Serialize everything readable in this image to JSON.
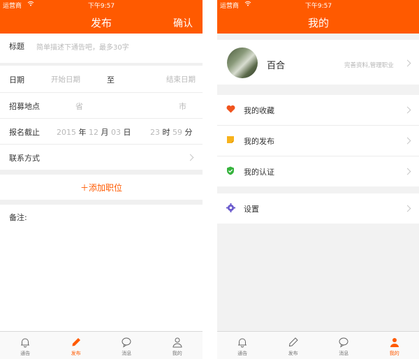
{
  "status_bar": {
    "carrier": "运营商",
    "time": "下午9:57"
  },
  "colors": {
    "brand": "#ff5a00",
    "heart": "#f0541e",
    "note": "#f7b21c",
    "shield": "#36b33d",
    "gear": "#6a5acd"
  },
  "publish": {
    "title": "发布",
    "confirm": "确认",
    "form": {
      "title_label": "标题",
      "title_placeholder": "简单描述下通告吧，最多30字",
      "date_label": "日期",
      "date_start": "开始日期",
      "date_to": "至",
      "date_end": "结束日期",
      "location_label": "招募地点",
      "province": "省",
      "city": "市",
      "deadline_label": "报名截止",
      "deadline_year": "2015",
      "deadline_year_unit": "年",
      "deadline_month": "12",
      "deadline_month_unit": "月",
      "deadline_day": "03",
      "deadline_day_unit": "日",
      "deadline_hour": "23",
      "deadline_hour_unit": "时",
      "deadline_minute": "59",
      "deadline_minute_unit": "分",
      "contact_label": "联系方式",
      "add_position": "＋添加职位",
      "remark_label": "备注:"
    }
  },
  "mine": {
    "title": "我的",
    "profile": {
      "name": "百合",
      "hint": "完善资料,管理职业"
    },
    "items": [
      {
        "label": "我的收藏",
        "icon": "heart-icon"
      },
      {
        "label": "我的发布",
        "icon": "note-icon"
      },
      {
        "label": "我的认证",
        "icon": "shield-check-icon"
      },
      {
        "label": "设置",
        "icon": "gear-icon"
      }
    ]
  },
  "tabs": [
    {
      "label": "通告",
      "icon": "bell-icon"
    },
    {
      "label": "发布",
      "icon": "pencil-icon"
    },
    {
      "label": "消息",
      "icon": "chat-bubble-icon"
    },
    {
      "label": "我的",
      "icon": "person-icon"
    }
  ]
}
